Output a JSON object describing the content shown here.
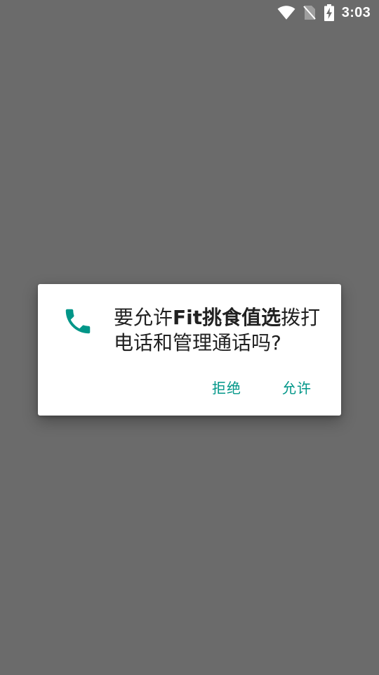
{
  "status_bar": {
    "time": "3:03",
    "icons": [
      "wifi-icon",
      "no-sim-icon",
      "battery-charging-icon"
    ],
    "icon_color": "#ffffff"
  },
  "dialog": {
    "icon": "phone-icon",
    "icon_color": "#009688",
    "message_prefix": "要允许",
    "app_name": "Fit挑食值选",
    "message_suffix": "拨打电话和管理通话吗?",
    "deny_label": "拒绝",
    "allow_label": "允许",
    "button_color": "#009688"
  },
  "scrim_color": "#6b6b6b"
}
